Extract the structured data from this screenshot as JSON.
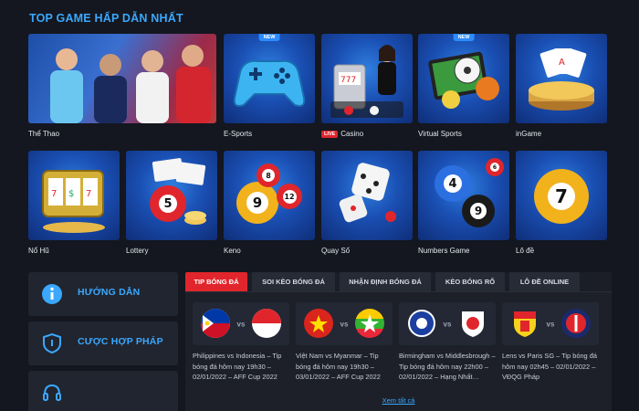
{
  "section_title": "TOP GAME HẤP DẪN NHẤT",
  "games": [
    {
      "id": "the-thao",
      "label": "Thể Thao"
    },
    {
      "id": "e-sports",
      "label": "E-Sports",
      "badge": "NEW"
    },
    {
      "id": "casino",
      "label": "Casino",
      "badge_live": "LIVE"
    },
    {
      "id": "virtual-sports",
      "label": "Virtual Sports",
      "badge": "NEW"
    },
    {
      "id": "ingame",
      "label": "inGame"
    },
    {
      "id": "no-hu",
      "label": "Nổ Hũ"
    },
    {
      "id": "lottery",
      "label": "Lottery"
    },
    {
      "id": "keno",
      "label": "Keno"
    },
    {
      "id": "quay-so",
      "label": "Quay Số"
    },
    {
      "id": "numbers-game",
      "label": "Numbers Game"
    },
    {
      "id": "lo-de",
      "label": "Lô đề"
    }
  ],
  "side_menu": [
    {
      "label": "HƯỚNG DẪN",
      "icon": "info-icon"
    },
    {
      "label": "CƯỢC HỢP PHÁP",
      "icon": "shield-icon"
    },
    {
      "label": "",
      "icon": "headset-icon"
    }
  ],
  "tabs": [
    "TIP BÓNG ĐÁ",
    "SOI KÈO BÓNG ĐÁ",
    "NHẬN ĐỊNH BÓNG ĐÁ",
    "KÈO BÓNG RỔ",
    "LÔ ĐỀ ONLINE"
  ],
  "active_tab": 0,
  "matches": [
    {
      "title": "Philippines vs Indonesia – Tip bóng đá hôm nay 19h30 – 02/01/2022 – AFF Cup 2022",
      "vs": "vs"
    },
    {
      "title": "Việt Nam vs Myanmar – Tip bóng đá hôm nay 19h30 – 03/01/2022 – AFF Cup 2022",
      "vs": "vs"
    },
    {
      "title": "Birmingham vs Middlesbrough – Tip bóng đá hôm nay 22h00 – 02/01/2022 – Hạng Nhất…",
      "vs": "vs"
    },
    {
      "title": "Lens vs Paris SG – Tip bóng đá hôm nay 02h45 – 02/01/2022 – VĐQG Pháp",
      "vs": "vs"
    }
  ],
  "see_all": "Xem tất cả",
  "colors": {
    "accent_blue": "#3aa8ff",
    "accent_red": "#e0262c",
    "bg": "#14171f"
  }
}
